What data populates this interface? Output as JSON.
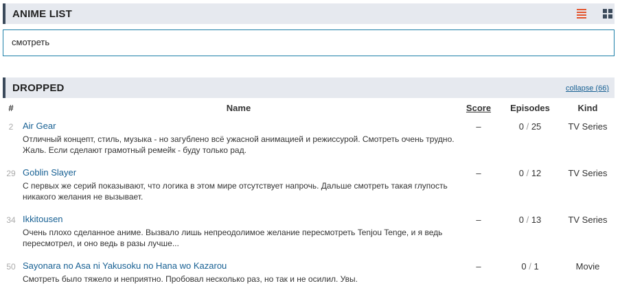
{
  "list_section": {
    "title": "ANIME LIST",
    "view_list_icon": "list-icon",
    "view_grid_icon": "grid-icon",
    "list_icon_color": "#e4522a",
    "grid_icon_color": "#3b4a5b"
  },
  "search": {
    "value": "смотреть",
    "border_color": "#1c7fa8"
  },
  "dropped_section": {
    "title": "DROPPED",
    "collapse_label": "collapse (66)"
  },
  "table": {
    "columns": {
      "num": "#",
      "name": "Name",
      "score": "Score",
      "episodes": "Episodes",
      "kind": "Kind"
    },
    "rows": [
      {
        "num": "2",
        "title": "Air Gear",
        "comment": "Отличный концепт, стиль, музыка - но загублено всё ужасной анимацией и режиссурой. Смотреть очень трудно. Жаль. Если сделают грамотный ремейк - буду только рад.",
        "score": "–",
        "watched": "0",
        "sep": "/",
        "total": "25",
        "kind": "TV Series"
      },
      {
        "num": "29",
        "title": "Goblin Slayer",
        "comment": "С первых же серий показывают, что логика в этом мире отсутствует напрочь. Дальше смотреть такая глупость никакого желания не вызывает.",
        "score": "–",
        "watched": "0",
        "sep": "/",
        "total": "12",
        "kind": "TV Series"
      },
      {
        "num": "34",
        "title": "Ikkitousen",
        "comment": "Очень плохо сделанное аниме. Вызвало лишь непреодолимое желание пересмотреть Tenjou Tenge, и я ведь пересмотрел, и оно ведь в разы лучше...",
        "score": "–",
        "watched": "0",
        "sep": "/",
        "total": "13",
        "kind": "TV Series"
      },
      {
        "num": "50",
        "title": "Sayonara no Asa ni Yakusoku no Hana wo Kazarou",
        "comment": "Смотреть было тяжело и неприятно. Пробовал несколько раз, но так и не осилил. Увы.",
        "score": "–",
        "watched": "0",
        "sep": "/",
        "total": "1",
        "kind": "Movie"
      }
    ]
  }
}
